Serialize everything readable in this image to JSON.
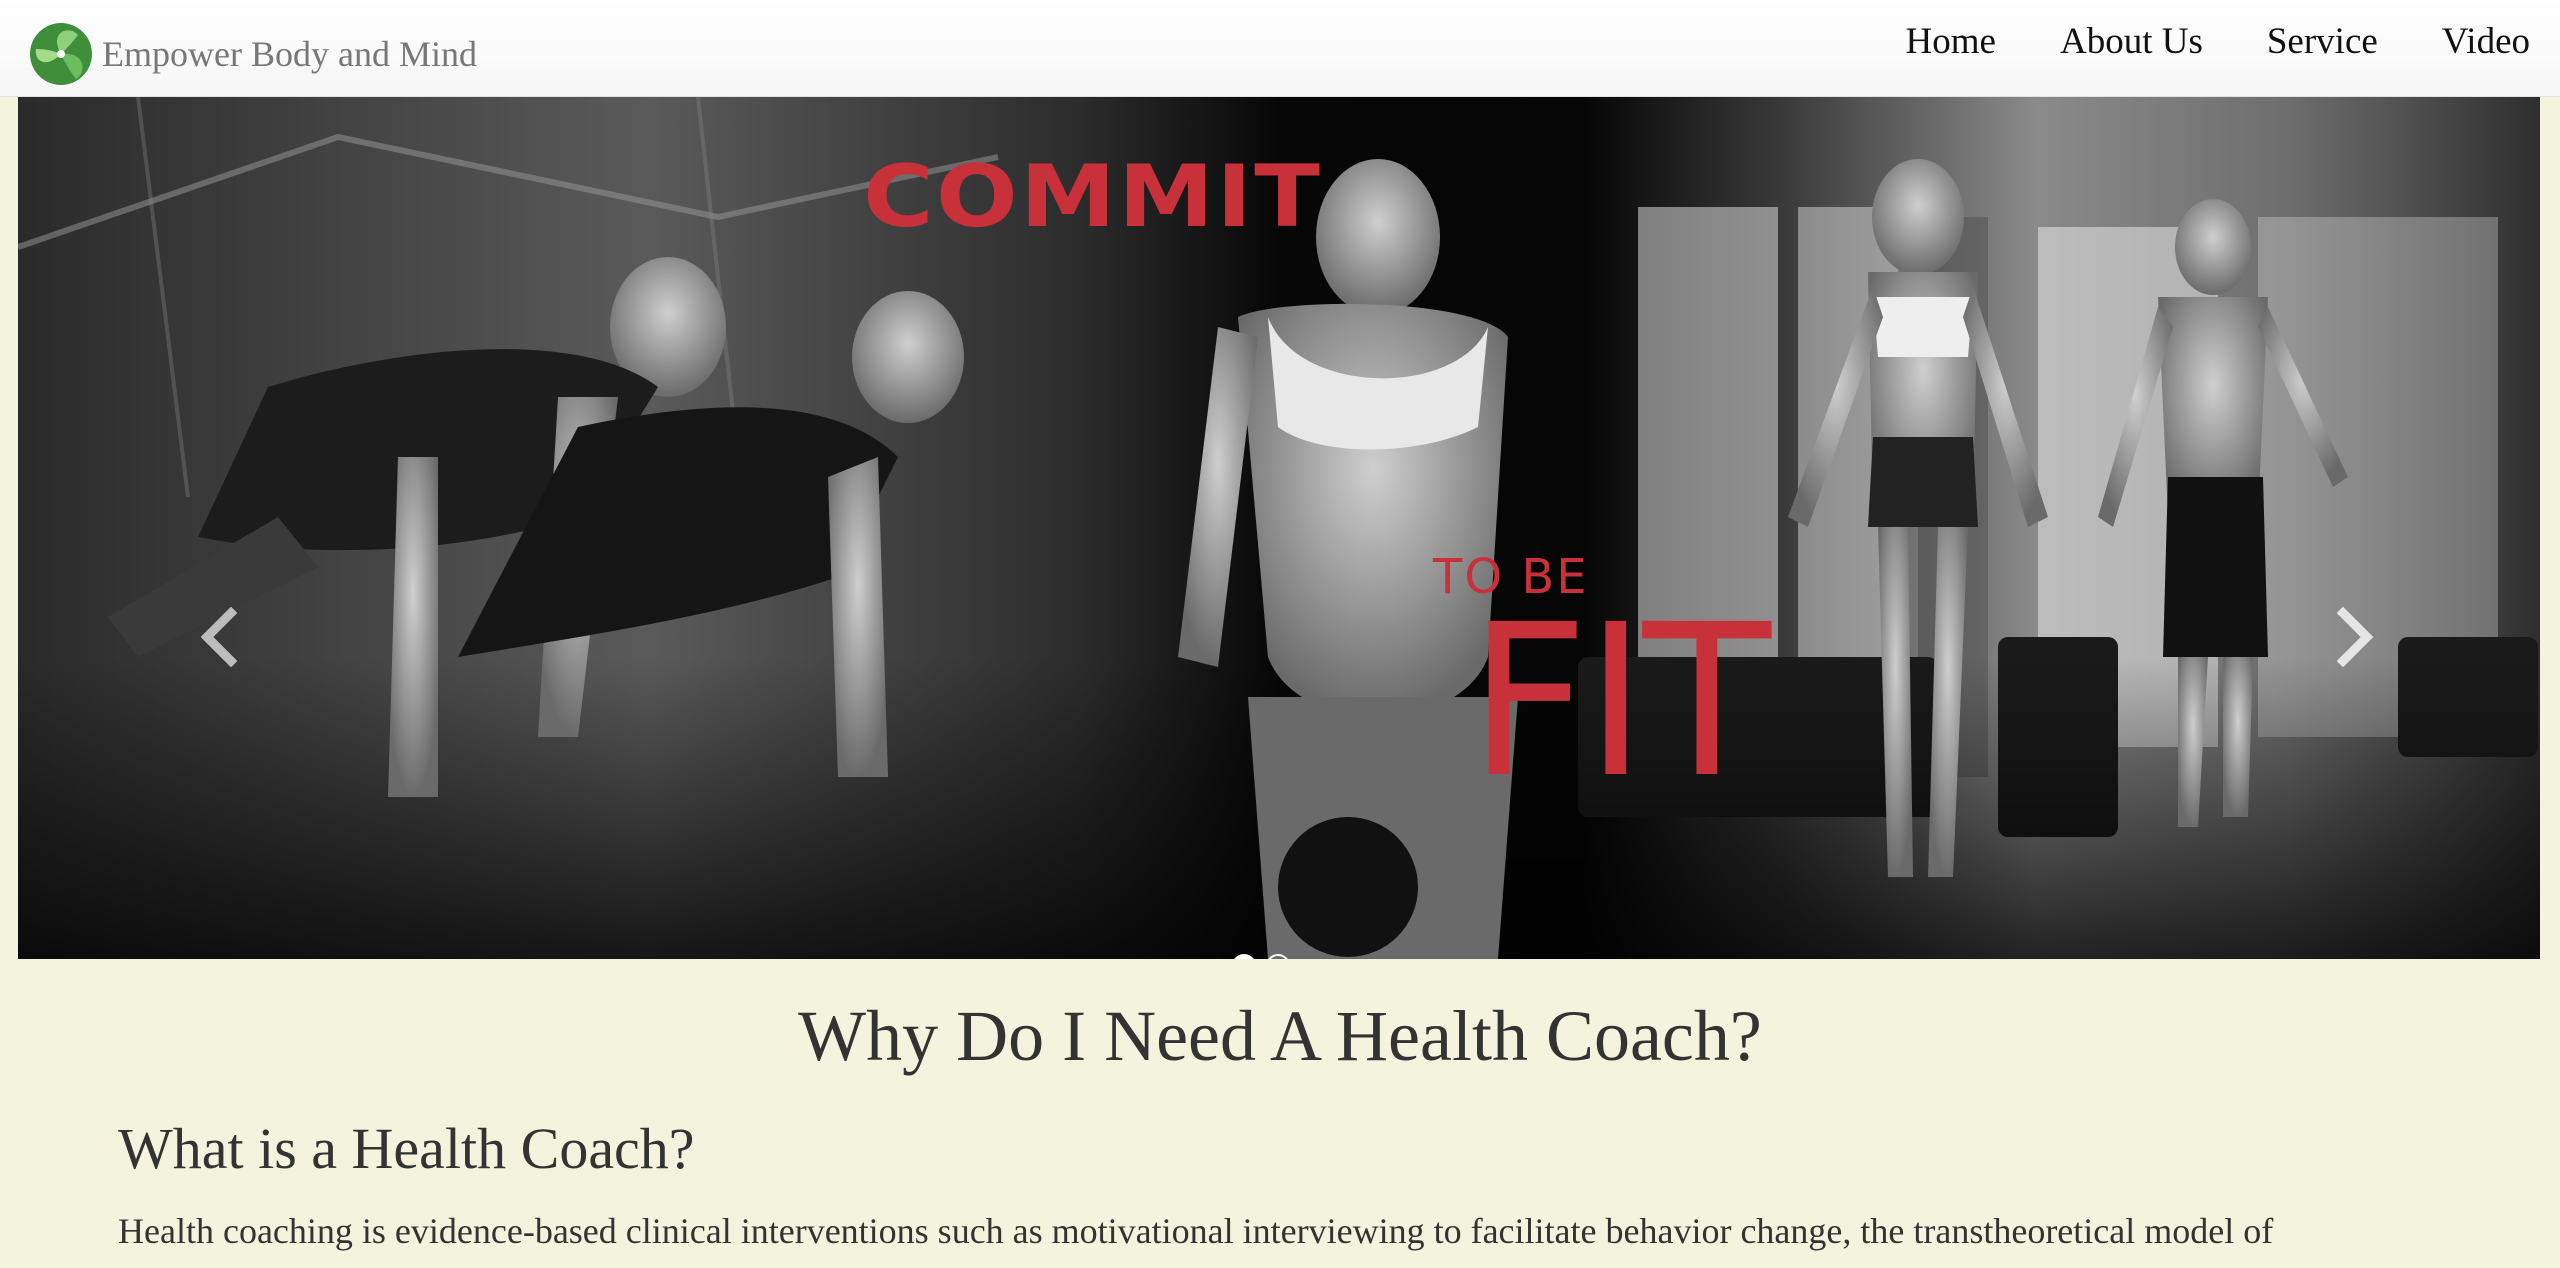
{
  "brand": {
    "name": "Empower Body and Mind",
    "logo_icon": "leaf-logo-icon",
    "logo_colors": [
      "#3f8f3a",
      "#7cc26a"
    ]
  },
  "nav": {
    "items": [
      {
        "label": "Home"
      },
      {
        "label": "About Us"
      },
      {
        "label": "Service"
      },
      {
        "label": "Video"
      }
    ]
  },
  "carousel": {
    "slide_text": {
      "line1": "COMMIT",
      "line2": "TO BE",
      "line3": "FIT"
    },
    "accent_color": "#c8303a",
    "prev_icon": "chevron-left-icon",
    "next_icon": "chevron-right-icon",
    "slide_count": 2,
    "active_slide": 1
  },
  "content": {
    "main_heading": "Why Do I Need A Health Coach?",
    "section_heading": "What is a Health Coach?",
    "section_body": "Health coaching is evidence-based clinical interventions such as motivational interviewing to facilitate behavior change, the transtheoretical model of"
  }
}
